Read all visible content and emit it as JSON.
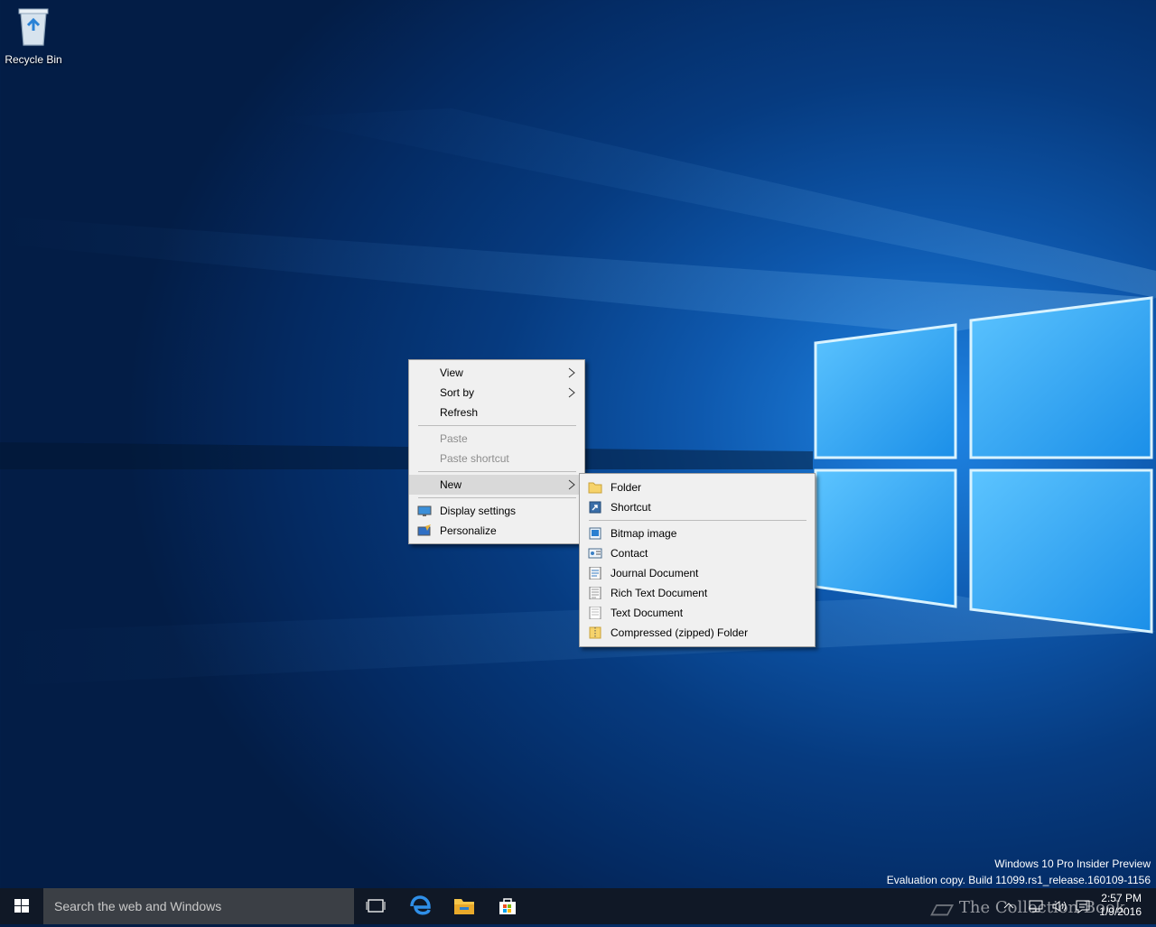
{
  "desktop": {
    "icons": [
      {
        "label": "Recycle Bin",
        "icon": "recycle-bin-icon"
      }
    ]
  },
  "context_menu": {
    "items": [
      {
        "label": "View",
        "submenu": true
      },
      {
        "label": "Sort by",
        "submenu": true
      },
      {
        "label": "Refresh"
      },
      {
        "label": "Paste",
        "disabled": true
      },
      {
        "label": "Paste shortcut",
        "disabled": true
      },
      {
        "label": "New",
        "submenu": true,
        "highlighted": true
      },
      {
        "label": "Display settings",
        "icon": "display-settings-icon"
      },
      {
        "label": "Personalize",
        "icon": "personalize-icon"
      }
    ]
  },
  "new_submenu": {
    "items": [
      {
        "label": "Folder",
        "icon": "folder-icon"
      },
      {
        "label": "Shortcut",
        "icon": "shortcut-icon"
      },
      {
        "label": "Bitmap image",
        "icon": "bitmap-image-icon"
      },
      {
        "label": "Contact",
        "icon": "contact-icon"
      },
      {
        "label": "Journal Document",
        "icon": "journal-document-icon"
      },
      {
        "label": "Rich Text Document",
        "icon": "rich-text-document-icon"
      },
      {
        "label": "Text Document",
        "icon": "text-document-icon"
      },
      {
        "label": "Compressed (zipped) Folder",
        "icon": "zip-folder-icon"
      }
    ]
  },
  "watermark": {
    "line1": "Windows 10 Pro Insider Preview",
    "line2": "Evaluation copy. Build 11099.rs1_release.160109-1156"
  },
  "taskbar": {
    "search_placeholder": "Search the web and Windows",
    "pinned": [
      "task-view-icon",
      "edge-icon",
      "file-explorer-icon",
      "store-icon"
    ],
    "clock_time": "2:57 PM",
    "clock_date": "1/9/2016",
    "branding": "The Collection Book"
  }
}
